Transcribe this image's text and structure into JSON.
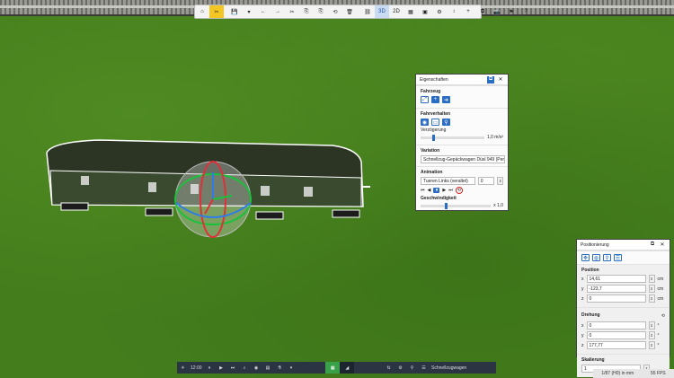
{
  "toolbar": {
    "items": [
      "⌂",
      "✂",
      "💾",
      "▾",
      "←",
      "→",
      "✂",
      "⎘",
      "⎘",
      "⟲",
      "🗑",
      "⛓",
      "3D",
      "2D",
      "▦",
      "▣",
      "⚙",
      "↕",
      "+",
      "⧉",
      "📷",
      "⚑",
      "?"
    ]
  },
  "props": {
    "title": "Eigenschaften",
    "fahrzeug": "Fahrzeug",
    "fahrverhalten": "Fahrverhalten",
    "verzoegerung": "Verzögerung",
    "verz_value": "1,0 m/s²",
    "variation": "Variation",
    "variation_value": "Schnellzug-Gepäckwagen Düsl 949 (Perläu",
    "animation": "Animation",
    "animation_value": "Tueren Links (veraltet)",
    "animation_num": "0",
    "geschwindigkeit": "Geschwindigkeit",
    "speed_value": "x 1,0"
  },
  "pos": {
    "title": "Positionierung",
    "position": "Position",
    "x_label": "x",
    "x_value": "14,61",
    "x_unit": "cm",
    "y_label": "y",
    "y_value": "-123,7",
    "y_unit": "cm",
    "z_label": "z",
    "z_value": "0",
    "z_unit": "cm",
    "drehung": "Drehung",
    "rx_value": "0",
    "ry_value": "0",
    "rz_value": "177,77",
    "deg": "°",
    "skalierung": "Skalierung",
    "scale_value": "1"
  },
  "bottom": {
    "time": "12:00",
    "label": "Schnellzugwagen"
  },
  "status": {
    "left": "1/87 (H0) in mm",
    "right": "55 FPS"
  },
  "colors": {
    "accent": "#2b6cc4",
    "highlight": "#f3c623",
    "grass": "#437d1c"
  }
}
